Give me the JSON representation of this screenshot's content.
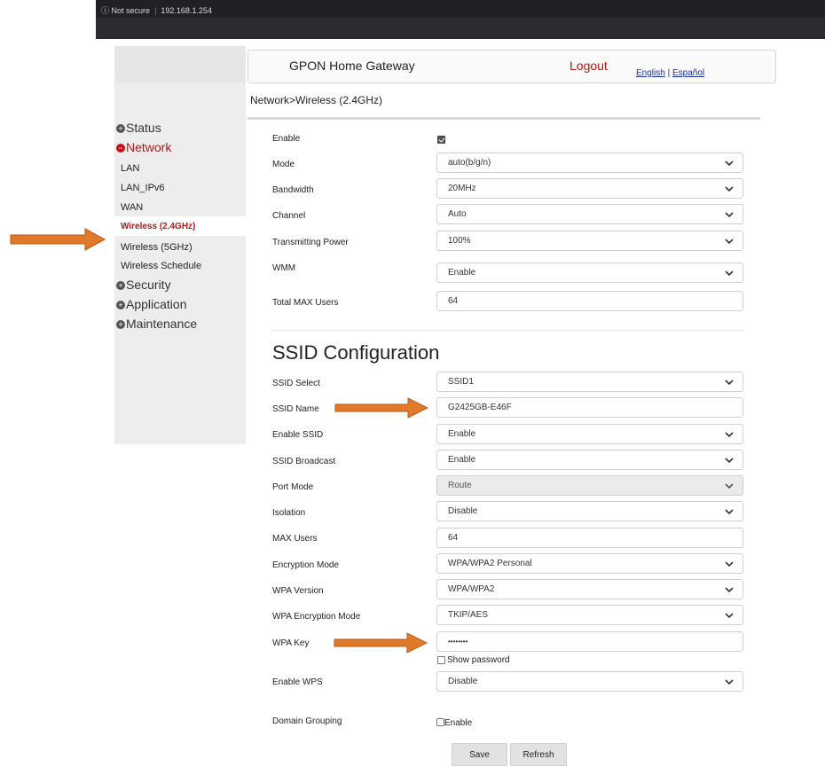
{
  "browser": {
    "security_text": "Not secure",
    "url": "192.168.1.254"
  },
  "header": {
    "title": "GPON Home Gateway",
    "logout": "Logout",
    "lang_en": "English",
    "lang_sep": " | ",
    "lang_es": "Español"
  },
  "breadcrumb": "Network>Wireless (2.4GHz)",
  "sidebar": {
    "status": "Status",
    "network": "Network",
    "items": [
      "LAN",
      "LAN_IPv6",
      "WAN",
      "Wireless (2.4GHz)",
      "Wireless (5GHz)",
      "Wireless Schedule"
    ],
    "security": "Security",
    "application": "Application",
    "maintenance": "Maintenance"
  },
  "wireless": {
    "enable_label": "Enable",
    "enable_checked": true,
    "mode_label": "Mode",
    "mode_value": "auto(b/g/n)",
    "bandwidth_label": "Bandwidth",
    "bandwidth_value": "20MHz",
    "channel_label": "Channel",
    "channel_value": "Auto",
    "power_label": "Transmitting Power",
    "power_value": "100%",
    "wmm_label": "WMM",
    "wmm_value": "Enable",
    "max_users_label": "Total MAX Users",
    "max_users_value": "64"
  },
  "ssid": {
    "section_title": "SSID Configuration",
    "select_label": "SSID Select",
    "select_value": "SSID1",
    "name_label": "SSID Name",
    "name_value": "G2425GB-E46F",
    "enable_label": "Enable SSID",
    "enable_value": "Enable",
    "broadcast_label": "SSID Broadcast",
    "broadcast_value": "Enable",
    "port_mode_label": "Port Mode",
    "port_mode_value": "Route",
    "isolation_label": "Isolation",
    "isolation_value": "Disable",
    "max_users_label": "MAX Users",
    "max_users_value": "64",
    "encryption_label": "Encryption Mode",
    "encryption_value": "WPA/WPA2 Personal",
    "wpa_version_label": "WPA Version",
    "wpa_version_value": "WPA/WPA2",
    "wpa_enc_label": "WPA Encryption Mode",
    "wpa_enc_value": "TKIP/AES",
    "wpa_key_label": "WPA Key",
    "wpa_key_value": "••••••••",
    "show_password_label": "Show password",
    "wps_label": "Enable WPS",
    "wps_value": "Disable",
    "domain_grouping_label": "Domain Grouping",
    "domain_grouping_option": "Enable"
  },
  "buttons": {
    "save": "Save",
    "refresh": "Refresh"
  },
  "colors": {
    "accent_red": "#b01818",
    "annotation_arrow": "#e07a2a",
    "link_blue": "#1a2f9e"
  }
}
